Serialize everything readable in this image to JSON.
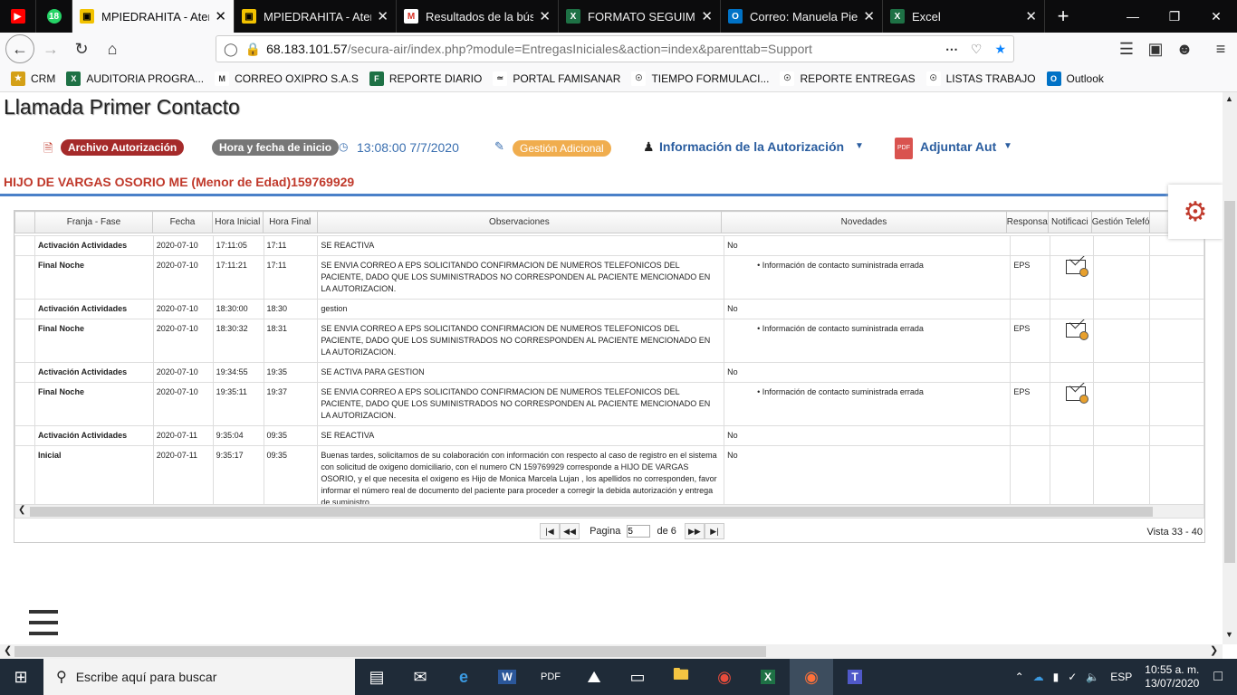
{
  "browser": {
    "tabs": [
      {
        "title": "",
        "icon": "youtube-icon",
        "badge": ""
      },
      {
        "title": "",
        "icon": "whatsapp-icon",
        "badge": "18"
      },
      {
        "title": "MPIEDRAHITA - Atenc",
        "icon": "suite-icon",
        "active": true
      },
      {
        "title": "MPIEDRAHITA - Atenc",
        "icon": "suite-icon"
      },
      {
        "title": "Resultados de la búsqu",
        "icon": "gmail-icon"
      },
      {
        "title": "FORMATO SEGUIMIEN",
        "icon": "excel-icon"
      },
      {
        "title": "Correo: Manuela Piedr",
        "icon": "outlook-icon"
      },
      {
        "title": "Excel",
        "icon": "excel-icon"
      }
    ],
    "url_host": "68.183.101.57",
    "url_path": "/secura-air/index.php?module=EntregasIniciales&action=index&parenttab=Support",
    "bookmarks": [
      "CRM",
      "AUDITORIA PROGRA...",
      "CORREO OXIPRO S.A.S",
      "REPORTE DIARIO",
      "PORTAL FAMISANAR",
      "TIEMPO FORMULACI...",
      "REPORTE ENTREGAS",
      "LISTAS TRABAJO",
      "Outlook"
    ]
  },
  "page": {
    "title": "Llamada Primer Contacto",
    "archivo_label": "Archivo Autorización",
    "hora_label": "Hora y fecha de inicio",
    "hora_value": "13:08:00 7/7/2020",
    "gestion_label": "Gestión Adicional",
    "info_label": "Información de la Autorización",
    "adjuntar_label": "Adjuntar Aut",
    "patient": "HIJO DE VARGAS OSORIO ME (Menor de Edad)159769929"
  },
  "grid": {
    "headers": [
      "Franja - Fase",
      "Fecha",
      "Hora Inicial",
      "Hora Final",
      "Observaciones",
      "Novedades",
      "Responsa",
      "Notificaci",
      "Gestión Telefó"
    ],
    "rows": [
      {
        "fase": "Activación Actividades",
        "fecha": "2020-07-10",
        "hi": "17:11:05",
        "hf": "17:11",
        "obs": "SE REACTIVA",
        "nov": "No",
        "resp": "",
        "mail": false
      },
      {
        "fase": "Final Noche",
        "fecha": "2020-07-10",
        "hi": "17:11:21",
        "hf": "17:11",
        "obs": "SE ENVIA CORREO A EPS SOLICITANDO CONFIRMACION DE NUMEROS TELEFONICOS DEL PACIENTE, DADO QUE LOS SUMINISTRADOS NO CORRESPONDEN AL PACIENTE MENCIONADO EN LA AUTORIZACION.",
        "nov": "• Información de contacto suministrada errada",
        "resp": "EPS",
        "mail": true
      },
      {
        "fase": "Activación Actividades",
        "fecha": "2020-07-10",
        "hi": "18:30:00",
        "hf": "18:30",
        "obs": "gestion",
        "nov": "No",
        "resp": "",
        "mail": false
      },
      {
        "fase": "Final Noche",
        "fecha": "2020-07-10",
        "hi": "18:30:32",
        "hf": "18:31",
        "obs": "SE ENVIA CORREO A EPS SOLICITANDO CONFIRMACION DE NUMEROS TELEFONICOS DEL PACIENTE, DADO QUE LOS SUMINISTRADOS NO CORRESPONDEN AL PACIENTE MENCIONADO EN LA AUTORIZACION.",
        "nov": "• Información de contacto suministrada errada",
        "resp": "EPS",
        "mail": true
      },
      {
        "fase": "Activación Actividades",
        "fecha": "2020-07-10",
        "hi": "19:34:55",
        "hf": "19:35",
        "obs": "SE ACTIVA PARA GESTION",
        "nov": "No",
        "resp": "",
        "mail": false
      },
      {
        "fase": "Final Noche",
        "fecha": "2020-07-10",
        "hi": "19:35:11",
        "hf": "19:37",
        "obs": "SE ENVIA CORREO A EPS SOLICITANDO CONFIRMACION DE NUMEROS TELEFONICOS DEL PACIENTE, DADO QUE LOS SUMINISTRADOS NO CORRESPONDEN AL PACIENTE MENCIONADO EN LA AUTORIZACION.",
        "nov": "• Información de contacto suministrada errada",
        "resp": "EPS",
        "mail": true
      },
      {
        "fase": "Activación Actividades",
        "fecha": "2020-07-11",
        "hi": "9:35:04",
        "hf": "09:35",
        "obs": "SE REACTIVA",
        "nov": "No",
        "resp": "",
        "mail": false
      },
      {
        "fase": "Inicial",
        "fecha": "2020-07-11",
        "hi": "9:35:17",
        "hf": "09:35",
        "obs": "Buenas tardes, solicitamos de su colaboración con información con respecto al caso de registro en el sistema con solicitud de oxigeno domiciliario, con el numero CN 159769929 corresponde a HIJO DE VARGAS OSORIO, y el que necesita el oxigeno es Hijo de Monica Marcela Lujan , los apellidos no corresponden, favor informar el número real de documento del paciente para proceder a corregir la debida autorización y entrega de suministro.",
        "nov": "No",
        "resp": "",
        "mail": false
      }
    ],
    "pager_label": "Pagina",
    "page_value": "5",
    "of_label": "de 6",
    "vista": "Vista 33 - 40"
  },
  "taskbar": {
    "search_placeholder": "Escribe aquí para buscar",
    "lang": "ESP",
    "time": "10:55 a. m.",
    "date": "13/07/2020"
  }
}
